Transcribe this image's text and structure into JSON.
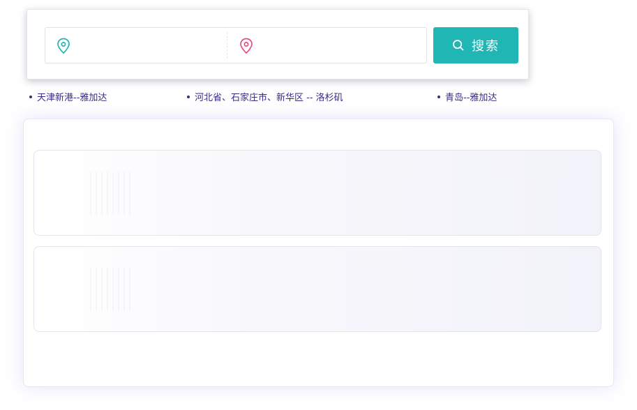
{
  "search": {
    "origin_placeholder": "",
    "destination_placeholder": "",
    "button_label": "搜索",
    "origin_icon": "location-pin-icon",
    "destination_icon": "location-pin-icon",
    "button_icon": "search-icon",
    "colors": {
      "accent": "#1fb6b4",
      "origin_pin": "#1fb6b4",
      "destination_pin": "#e94b7f"
    }
  },
  "popular_routes": [
    {
      "label": "天津新港--雅加达"
    },
    {
      "label": "河北省、石家庄市、新华区 -- 洛杉矶"
    },
    {
      "label": "青岛--雅加达"
    }
  ],
  "route_color": "#3b2a86",
  "results": {
    "skeleton_cards": 2
  }
}
